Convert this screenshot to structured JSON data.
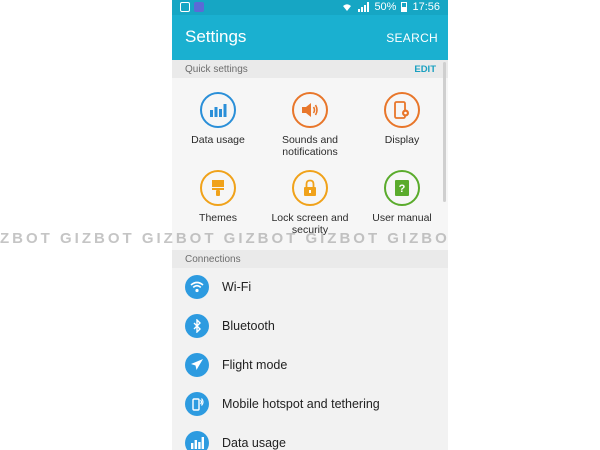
{
  "status_bar": {
    "battery": "50%",
    "time": "17:56",
    "icons": [
      "gallery-icon",
      "search-app-icon",
      "wifi-icon",
      "signal-icon",
      "battery-icon"
    ]
  },
  "app_bar": {
    "title": "Settings",
    "search_label": "SEARCH"
  },
  "quick_settings": {
    "header": "Quick settings",
    "edit_label": "EDIT",
    "tiles": [
      {
        "label": "Data usage",
        "icon": "data-usage-icon",
        "color": "#2a8fd8"
      },
      {
        "label": "Sounds and notifications",
        "line1": "Sounds and",
        "line2": "notifications",
        "icon": "speaker-icon",
        "color": "#e8762a"
      },
      {
        "label": "Display",
        "icon": "display-icon",
        "color": "#e8762a"
      },
      {
        "label": "Themes",
        "icon": "paintbrush-icon",
        "color": "#f0a21a"
      },
      {
        "label": "Lock screen and security",
        "line1": "Lock screen and",
        "line2": "security",
        "icon": "lock-icon",
        "color": "#f0a21a"
      },
      {
        "label": "User manual",
        "icon": "manual-icon",
        "color": "#5aab2c"
      }
    ]
  },
  "connections": {
    "header": "Connections",
    "items": [
      {
        "label": "Wi-Fi",
        "icon": "wifi-icon"
      },
      {
        "label": "Bluetooth",
        "icon": "bluetooth-icon"
      },
      {
        "label": "Flight mode",
        "icon": "airplane-icon"
      },
      {
        "label": "Mobile hotspot and tethering",
        "icon": "hotspot-icon"
      },
      {
        "label": "Data usage",
        "icon": "data-usage-icon"
      }
    ]
  },
  "watermark": "ZBOT GIZBOT GIZBOT GIZBOT GIZBOT GIZBO",
  "colors": {
    "accent": "#1ab0d0",
    "status_bar": "#16a6c4",
    "list_icon": "#2d9be0"
  }
}
